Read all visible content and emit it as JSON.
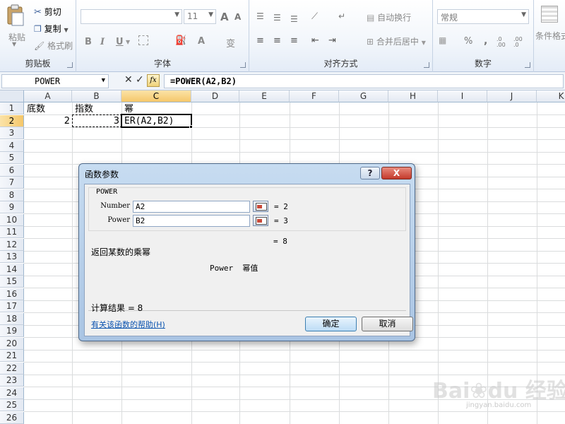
{
  "ribbon": {
    "clipboard": {
      "paste_label": "粘贴",
      "cut_label": "剪切",
      "copy_label": "复制",
      "format_painter_label": "格式刷",
      "group_label": "剪贴板"
    },
    "font": {
      "font_size": "11",
      "grow_label": "A",
      "shrink_label": "A",
      "bold_label": "B",
      "italic_label": "I",
      "underline_label": "U",
      "font_color_label": "A",
      "phonetic_label": "变",
      "group_label": "字体"
    },
    "alignment": {
      "wrap_text_label": "自动换行",
      "merge_center_label": "合并后居中",
      "group_label": "对齐方式"
    },
    "number": {
      "format_value": "常规",
      "percent_label": "%",
      "comma_label": ",",
      "increase_decimal_label": ".0 .00",
      "decrease_decimal_label": ".00 .0",
      "group_label": "数字"
    },
    "styles": {
      "conditional_format_label": "条件格式"
    }
  },
  "formula_bar": {
    "name_box": "POWER",
    "fx_label": "fx",
    "formula": "=POWER(A2,B2)"
  },
  "sheet": {
    "columns": [
      "A",
      "B",
      "C",
      "D",
      "E",
      "F",
      "G",
      "H",
      "I",
      "J",
      "K"
    ],
    "selected_column": "C",
    "rows": [
      "1",
      "2",
      "3",
      "4",
      "5",
      "6",
      "7",
      "8",
      "9",
      "10",
      "11",
      "12",
      "13",
      "14",
      "15",
      "16",
      "17",
      "18",
      "19",
      "20",
      "21",
      "22",
      "23",
      "24",
      "25",
      "26"
    ],
    "selected_row": "2",
    "cells": {
      "A1": "底数",
      "B1": "指数",
      "C1": "幂",
      "A2": "2",
      "B2": "3",
      "C2": "ER(A2,B2)"
    }
  },
  "dialog": {
    "title": "函数参数",
    "help_button": "?",
    "close_button": "X",
    "function_name": "POWER",
    "args": [
      {
        "label": "Number",
        "value": "A2",
        "result": "= 2"
      },
      {
        "label": "Power",
        "value": "B2",
        "result": "= 3"
      }
    ],
    "overall_result": "= 8",
    "description": "返回某数的乘幂",
    "arg_description": "Power  幂值",
    "calc_result": "计算结果 = 8",
    "help_link": "有关该函数的帮助(H)",
    "ok_label": "确定",
    "cancel_label": "取消"
  },
  "watermark": {
    "brand": "Bai",
    "brand_tail": "du 经验",
    "url": "jingyan.baidu.com"
  }
}
